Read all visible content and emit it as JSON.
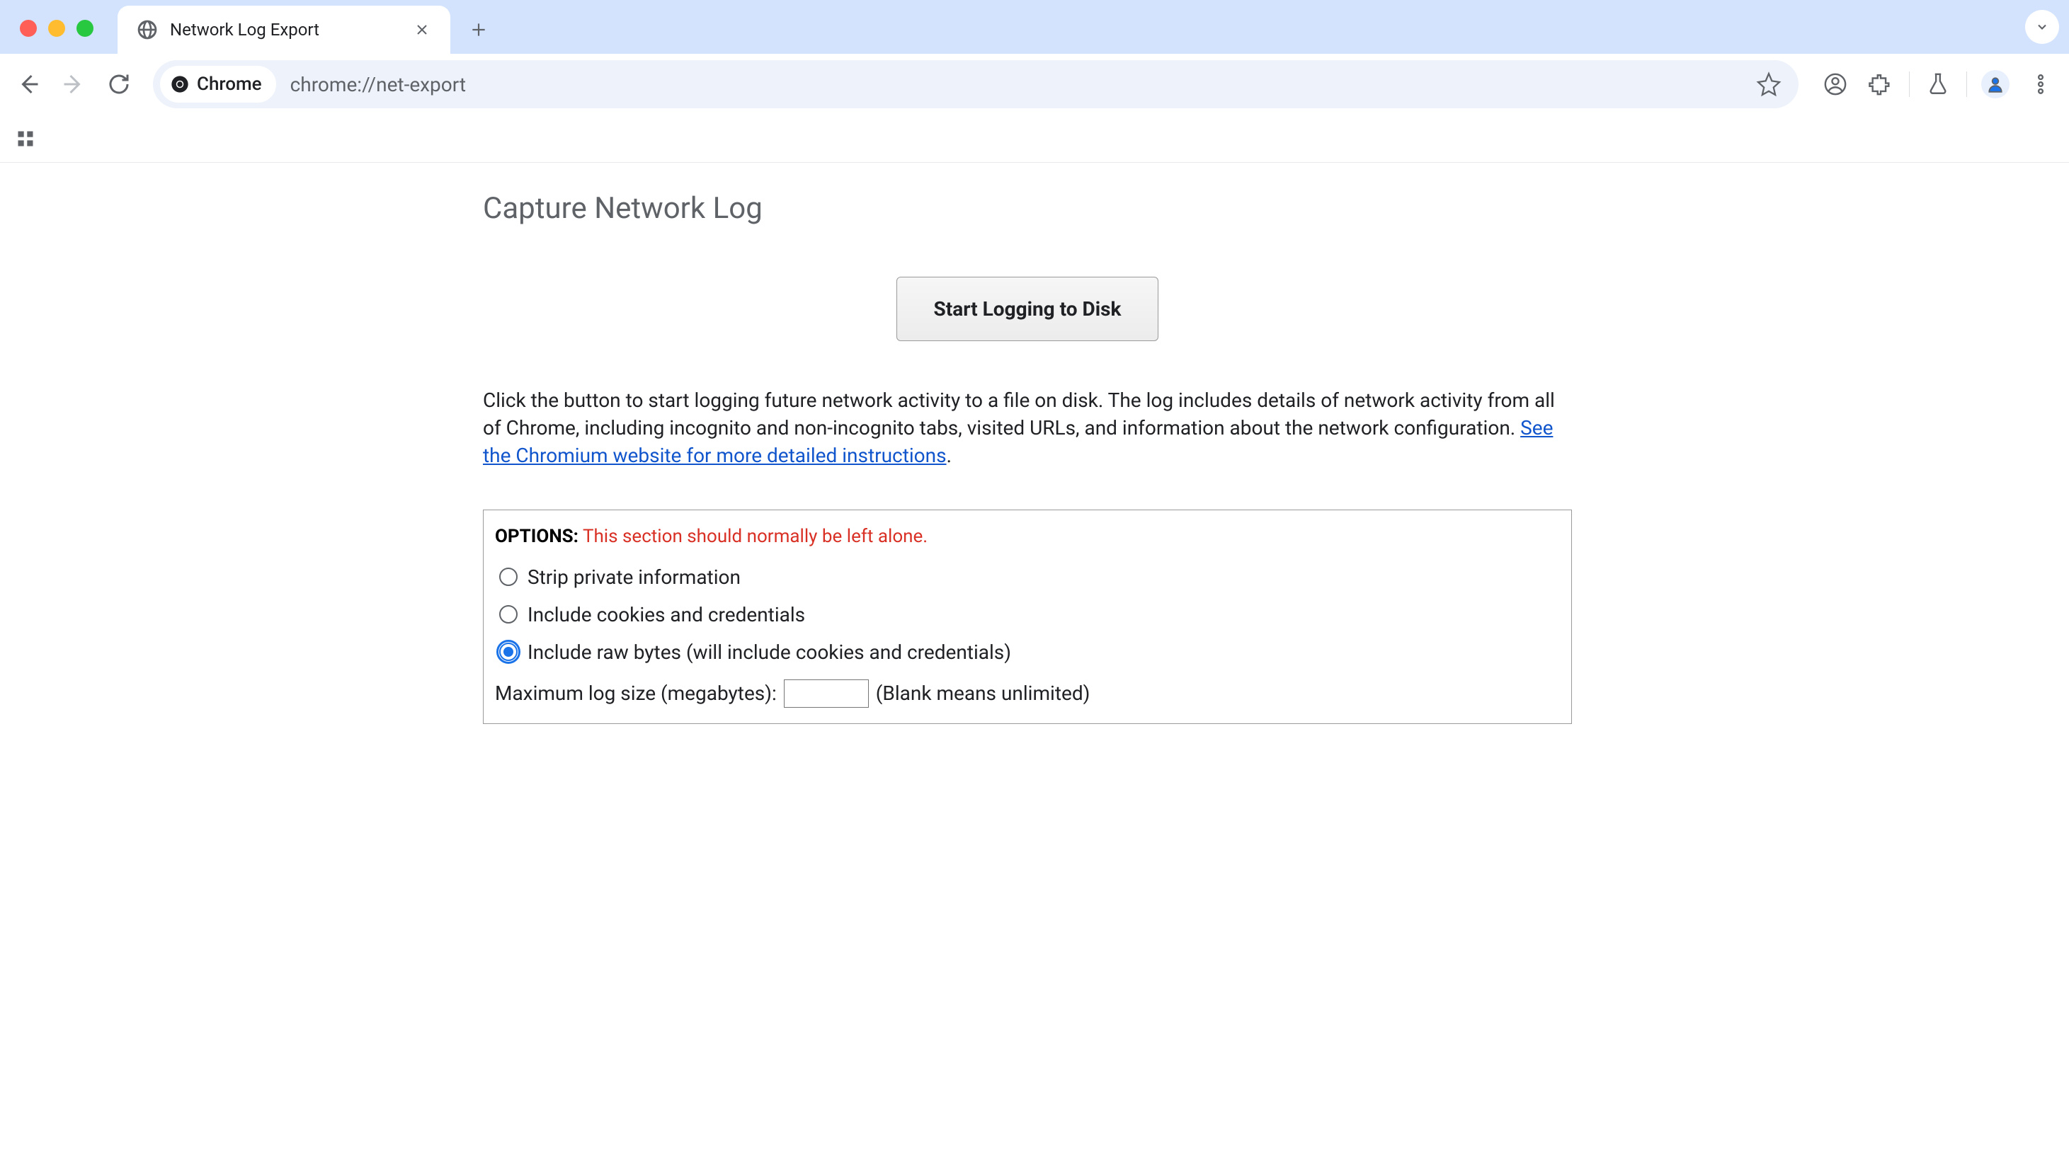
{
  "tab": {
    "title": "Network Log Export"
  },
  "addressBar": {
    "chipLabel": "Chrome",
    "url": "chrome://net-export"
  },
  "page": {
    "title": "Capture Network Log",
    "startButton": "Start Logging to Disk",
    "descriptionPrefix": "Click the button to start logging future network activity to a file on disk. The log includes details of network activity from all of Chrome, including incognito and non-incognito tabs, visited URLs, and information about the network configuration. ",
    "descriptionLink": "See the Chromium website for more detailed instructions",
    "descriptionSuffix": "."
  },
  "options": {
    "label": "OPTIONS:",
    "warning": " This section should normally be left alone.",
    "radios": [
      {
        "label": "Strip private information",
        "checked": false
      },
      {
        "label": "Include cookies and credentials",
        "checked": false
      },
      {
        "label": "Include raw bytes (will include cookies and credentials)",
        "checked": true
      }
    ],
    "maxSizeLabel": "Maximum log size (megabytes):",
    "maxSizeValue": "",
    "maxSizeHint": "(Blank means unlimited)"
  }
}
